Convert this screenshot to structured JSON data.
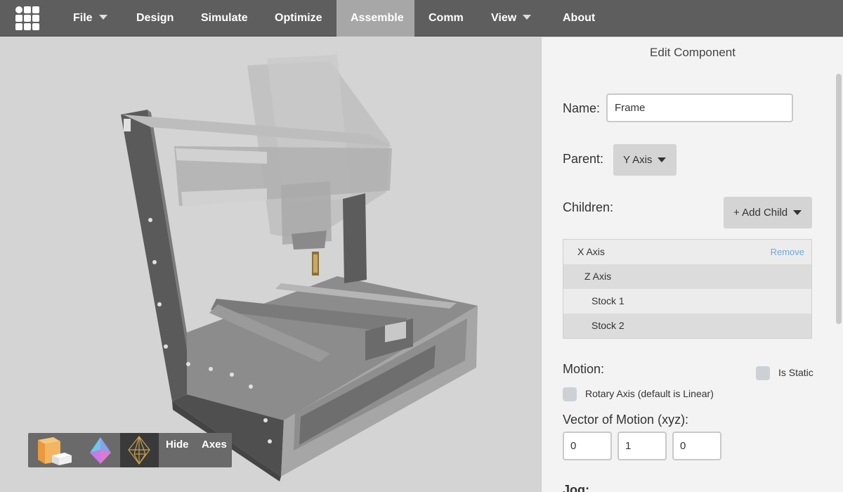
{
  "nav": {
    "items": [
      {
        "label": "File",
        "has_dropdown": true
      },
      {
        "label": "Design",
        "has_dropdown": false
      },
      {
        "label": "Simulate",
        "has_dropdown": false
      },
      {
        "label": "Optimize",
        "has_dropdown": false
      },
      {
        "label": "Assemble",
        "has_dropdown": false,
        "active": true
      },
      {
        "label": "Comm",
        "has_dropdown": false
      },
      {
        "label": "View",
        "has_dropdown": true
      },
      {
        "label": "About",
        "has_dropdown": false
      }
    ]
  },
  "viewport": {
    "toolbar": {
      "buttons": [
        "box-view-icon",
        "octahedron-icon",
        "wireframe-octahedron-icon"
      ],
      "hide_label": "Hide",
      "axes_label": "Axes"
    }
  },
  "panel": {
    "title": "Edit Component",
    "name_label": "Name:",
    "name_value": "Frame",
    "parent_label": "Parent:",
    "parent_value": "Y Axis",
    "children_label": "Children:",
    "add_child_label": "+ Add Child",
    "children": [
      {
        "name": "X Axis",
        "action": "Remove"
      },
      {
        "name": "Z Axis"
      },
      {
        "name": "Stock 1"
      },
      {
        "name": "Stock 2"
      }
    ],
    "motion_label": "Motion:",
    "is_static_label": "Is Static",
    "rotary_label": "Rotary Axis (default is Linear)",
    "vector_label": "Vector of Motion (xyz):",
    "vector": [
      "0",
      "1",
      "0"
    ],
    "jog_label": "Jog:"
  },
  "colors": {
    "topbar": "#5e5e5e",
    "active_tab": "#a7a7a7",
    "panel_bg": "#f3f3f3",
    "remove_link": "#6fa8dc",
    "viewport_bg": "#d4d4d4"
  }
}
